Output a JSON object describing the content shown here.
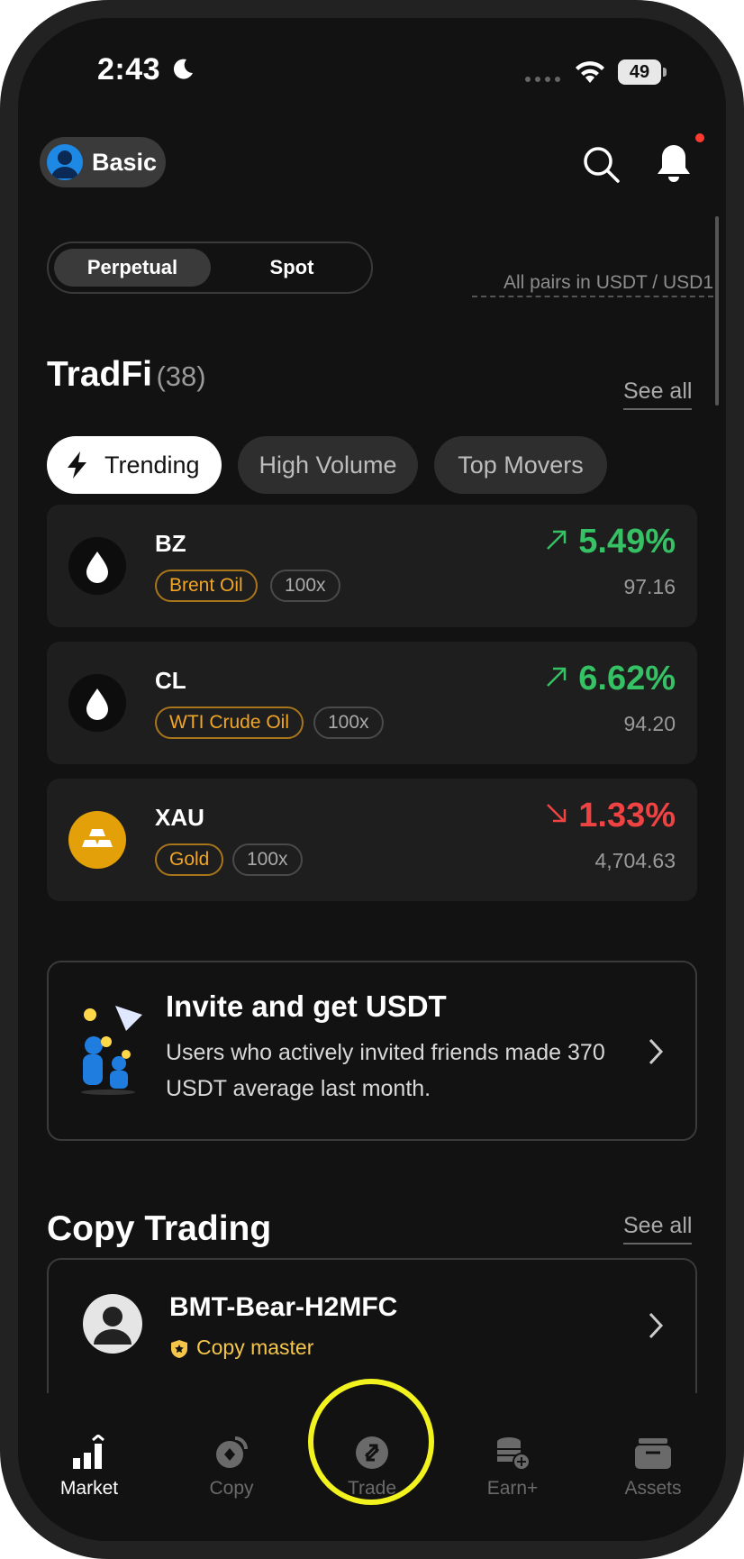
{
  "status_bar": {
    "time": "2:43",
    "battery": "49"
  },
  "header": {
    "account_label": "Basic"
  },
  "segment": {
    "active": "Perpetual",
    "inactive": "Spot",
    "pairs_note": "All pairs in USDT / USD1"
  },
  "tradfi": {
    "title": "TradFi",
    "count": "(38)",
    "see_all": "See all",
    "filters": [
      "Trending",
      "High Volume",
      "Top Movers"
    ],
    "items": [
      {
        "symbol": "BZ",
        "name": "Brent Oil",
        "leverage": "100x",
        "change": "5.49%",
        "price": "97.16",
        "direction": "up",
        "icon": "oil-drop-icon"
      },
      {
        "symbol": "CL",
        "name": "WTI Crude Oil",
        "leverage": "100x",
        "change": "6.62%",
        "price": "94.20",
        "direction": "up",
        "icon": "oil-drop-icon"
      },
      {
        "symbol": "XAU",
        "name": "Gold",
        "leverage": "100x",
        "change": "1.33%",
        "price": "4,704.63",
        "direction": "down",
        "icon": "gold-bars-icon"
      }
    ]
  },
  "invite": {
    "title": "Invite and get USDT",
    "description": "Users who actively invited friends made 370 USDT average last month."
  },
  "copy_trading": {
    "title": "Copy Trading",
    "see_all": "See all",
    "trader": {
      "name": "BMT-Bear-H2MFC",
      "badge": "Copy master"
    }
  },
  "bottom_nav": [
    {
      "label": "Market",
      "icon": "market-bars-icon",
      "active": true
    },
    {
      "label": "Copy",
      "icon": "copy-icon",
      "active": false
    },
    {
      "label": "Trade",
      "icon": "trade-swap-icon",
      "active": false
    },
    {
      "label": "Earn+",
      "icon": "earn-coins-icon",
      "active": false
    },
    {
      "label": "Assets",
      "icon": "wallet-icon",
      "active": false
    }
  ],
  "colors": {
    "up": "#35c164",
    "down": "#ef4343",
    "tag": "#f1a626",
    "highlight": "#f2f21e"
  }
}
